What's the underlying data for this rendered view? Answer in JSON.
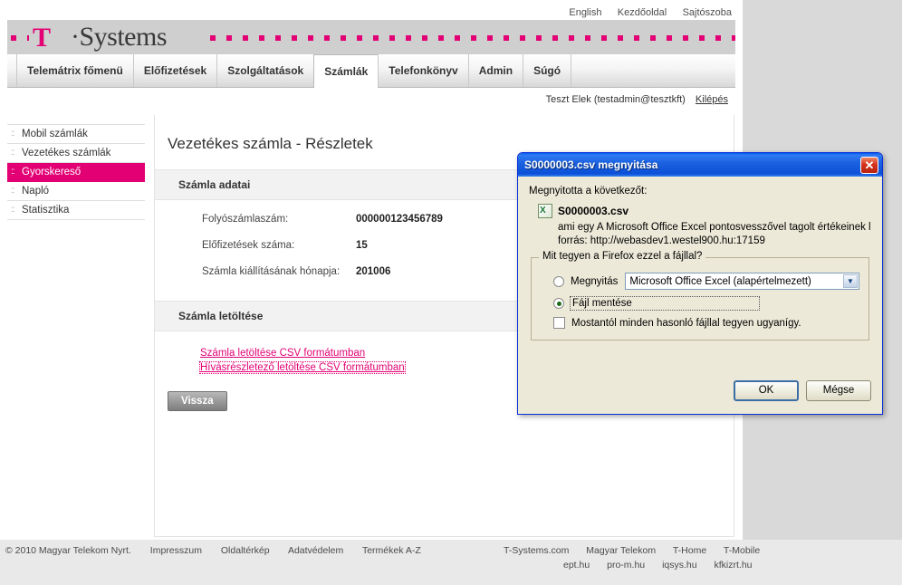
{
  "toplinks": [
    {
      "label": "English"
    },
    {
      "label": "Kezdőoldal"
    },
    {
      "label": "Sajtószoba"
    }
  ],
  "brand": {
    "logo_t": "T",
    "logo_word": "·Systems",
    "accent_color": "#e20074"
  },
  "nav": {
    "tabs": [
      {
        "label": "Telemátrix főmenü",
        "active": false
      },
      {
        "label": "Előfizetések",
        "active": false
      },
      {
        "label": "Szolgáltatások",
        "active": false
      },
      {
        "label": "Számlák",
        "active": true
      },
      {
        "label": "Telefonkönyv",
        "active": false
      },
      {
        "label": "Admin",
        "active": false
      },
      {
        "label": "Súgó",
        "active": false
      }
    ]
  },
  "userbar": {
    "user": "Teszt Elek (testadmin@tesztkft)",
    "logout": "Kilépés"
  },
  "sidebar": {
    "items": [
      {
        "label": "Mobil számlák",
        "selected": false
      },
      {
        "label": "Vezetékes számlák",
        "selected": false
      },
      {
        "label": "Gyorskereső",
        "selected": true
      },
      {
        "label": "Napló",
        "selected": false
      },
      {
        "label": "Statisztika",
        "selected": false
      }
    ]
  },
  "main": {
    "page_title": "Vezetékes számla - Részletek",
    "section_invoice_data": "Számla adatai",
    "fields": [
      {
        "label": "Folyószámlaszám:",
        "value": "000000123456789"
      },
      {
        "label": "Előfizetések száma:",
        "value": "15"
      },
      {
        "label": "Számla kiállításának hónapja:",
        "value": "201006"
      }
    ],
    "section_download": "Számla letöltése",
    "links": [
      {
        "label": "Számla letöltése CSV formátumban",
        "focused": false
      },
      {
        "label": "Hívásrészletező letöltése CSV formátumban",
        "focused": true
      }
    ],
    "back_button": "Vissza"
  },
  "footer": {
    "copyright": "© 2010 Magyar Telekom Nyrt.",
    "left_links": [
      "Impresszum",
      "Oldaltérkép",
      "Adatvédelem",
      "Termékek A-Z"
    ],
    "right_row1": [
      "T-Systems.com",
      "Magyar Telekom",
      "T-Home",
      "T-Mobile"
    ],
    "right_row2": [
      "ept.hu",
      "pro-m.hu",
      "iqsys.hu",
      "kfkizrt.hu"
    ]
  },
  "dialog": {
    "title": "S0000003.csv megnyitása",
    "close_label": "✕",
    "intro": "Megnyitotta a következőt:",
    "file_name": "S0000003.csv",
    "file_type_line": "ami egy  A Microsoft Office Excel pontosvesszővel tagolt értékeinek l",
    "file_source_line": "forrás: http://webasdev1.westel900.hu:17159",
    "question": "Mit tegyen a Firefox ezzel a fájllal?",
    "open_label": "Megnyitás",
    "open_app": "Microsoft Office Excel (alapértelmezett)",
    "save_label": "Fájl mentése",
    "remember_label": "Mostantól minden hasonló fájllal tegyen ugyanígy.",
    "ok_label": "OK",
    "cancel_label": "Mégse"
  }
}
